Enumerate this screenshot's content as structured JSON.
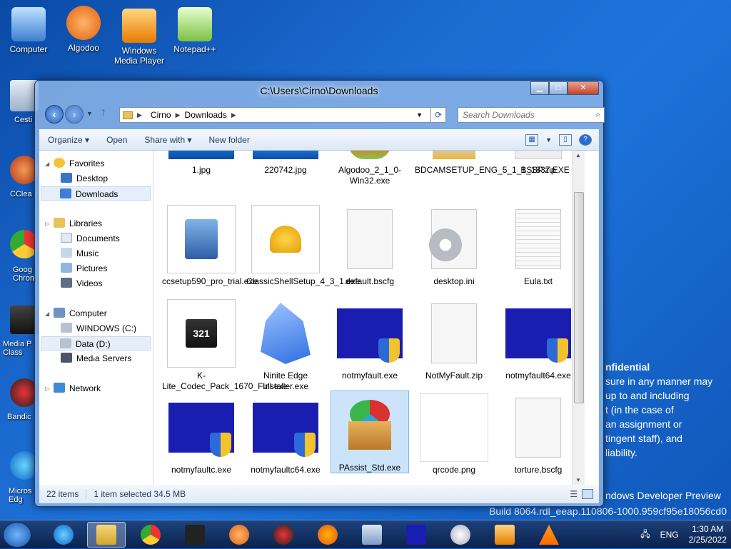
{
  "desktop": {
    "icons": [
      {
        "label": "Computer"
      },
      {
        "label": "Algodoo"
      },
      {
        "label": "Windows Media Player"
      },
      {
        "label": "Notepad++"
      }
    ],
    "left_column_partial": [
      "Cesti",
      "CClea",
      "Goog Chron",
      "Media P Class",
      "Bandic",
      "Micros Edg"
    ],
    "watermark": {
      "title": "nfidential",
      "lines": [
        "sure in any manner may",
        "up to and including",
        "t (in the case of",
        "an assignment or",
        "tingent staff), and",
        "liability."
      ],
      "preview": "ndows Developer Preview",
      "build": "Build 8064.rdl_eeap.110806-1000.959cf95e18056cd0"
    }
  },
  "window": {
    "title": "C:\\Users\\Cirno\\Downloads",
    "caption": {
      "minimize": "▁",
      "maximize": "□",
      "close": "✕"
    },
    "address": {
      "crumbs": [
        "Cirno",
        "Downloads"
      ]
    },
    "search": {
      "placeholder": "Search Downloads"
    },
    "toolbar": {
      "organize": "Organize ▾",
      "open": "Open",
      "share_with": "Share with ▾",
      "new_folder": "New folder"
    },
    "nav": {
      "favorites": "Favorites",
      "desktop": "Desktop",
      "downloads": "Downloads",
      "libraries": "Libraries",
      "documents": "Documents",
      "music": "Music",
      "pictures": "Pictures",
      "videos": "Videos",
      "computer": "Computer",
      "drive_c": "WINDOWS (C:)",
      "drive_d": "Data (D:)",
      "media_servers": "Media Servers",
      "network": "Network"
    },
    "files": [
      {
        "name": "1.jpg"
      },
      {
        "name": "220742.jpg"
      },
      {
        "name": "Algodoo_2_1_0-Win32.exe"
      },
      {
        "name": "BDCAMSETUP_ENG_5_1_1_1837.EXE"
      },
      {
        "name": "BSSP.zip"
      },
      {
        "name": "ccsetup590_pro_trial.exe"
      },
      {
        "name": "ClassicShellSetup_4_3_1.exe"
      },
      {
        "name": "default.bscfg"
      },
      {
        "name": "desktop.ini"
      },
      {
        "name": "Eula.txt"
      },
      {
        "name": "K-Lite_Codec_Pack_1670_Full.exe"
      },
      {
        "name": "Ninite Edge Installer.exe"
      },
      {
        "name": "notmyfault.exe"
      },
      {
        "name": "NotMyFault.zip"
      },
      {
        "name": "notmyfault64.exe"
      },
      {
        "name": "notmyfaultc.exe"
      },
      {
        "name": "notmyfaultc64.exe"
      },
      {
        "name": "PAssist_Std.exe"
      },
      {
        "name": "qrcode.png"
      },
      {
        "name": "torture.bscfg"
      }
    ],
    "status": {
      "count": "22 items",
      "selection": "1 item selected  34.5 MB"
    }
  },
  "taskbar": {
    "tray": {
      "lang": "ENG",
      "time": "1:30 AM",
      "date": "2/25/2022"
    }
  },
  "colors": {
    "selection": "#cce4fb",
    "desktop": "#1b6ad0"
  }
}
